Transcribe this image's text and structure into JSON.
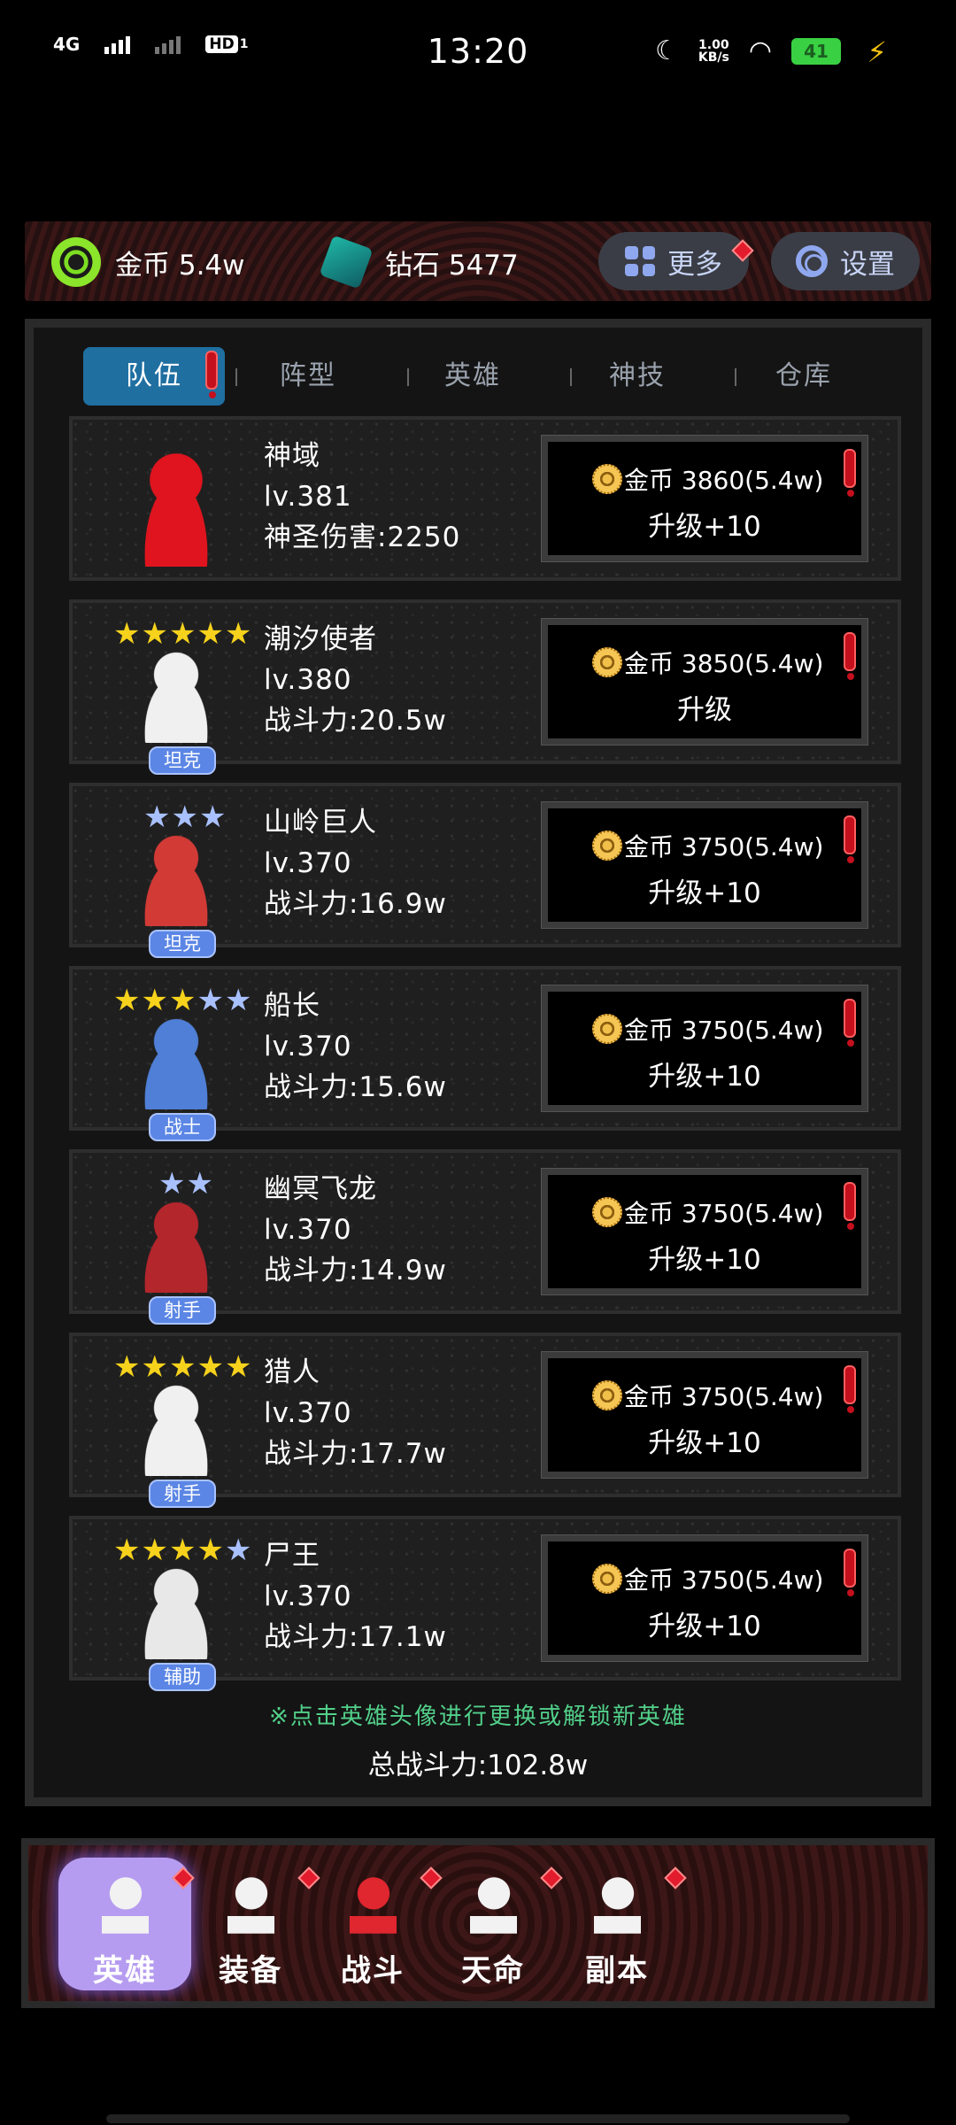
{
  "status_bar": {
    "network": "4G",
    "hd_label": "HD",
    "sim_index": "1",
    "time": "13:20",
    "speed_value": "1.00",
    "speed_unit": "KB/s",
    "battery": "41"
  },
  "resources": {
    "gold_label": "金币 5.4w",
    "diamond_label": "钻石 5477"
  },
  "top_buttons": {
    "more_label": "更多",
    "settings_label": "设置"
  },
  "tabs": [
    {
      "label": "队伍",
      "active": true,
      "alert": true
    },
    {
      "label": "阵型"
    },
    {
      "label": "英雄"
    },
    {
      "label": "神技"
    },
    {
      "label": "仓库"
    }
  ],
  "heroes": [
    {
      "name": "神域",
      "level": "lv.381",
      "stat": "神圣伤害:2250",
      "stars": 0,
      "gold_stars": 0,
      "role": "",
      "cost": "金币 3860(5.4w)",
      "action": "升级+10",
      "color": "#e0141e"
    },
    {
      "name": "潮汐使者",
      "level": "lv.380",
      "stat": "战斗力:20.5w",
      "stars": 5,
      "gold_stars": 5,
      "role": "坦克",
      "cost": "金币 3850(5.4w)",
      "action": "升级",
      "color": "#f0f0f0"
    },
    {
      "name": "山岭巨人",
      "level": "lv.370",
      "stat": "战斗力:16.9w",
      "stars": 3,
      "gold_stars": 0,
      "role": "坦克",
      "cost": "金币 3750(5.4w)",
      "action": "升级+10",
      "color": "#d23a36"
    },
    {
      "name": "船长",
      "level": "lv.370",
      "stat": "战斗力:15.6w",
      "stars": 5,
      "gold_stars": 3,
      "role": "战士",
      "cost": "金币 3750(5.4w)",
      "action": "升级+10",
      "color": "#4f7fd6"
    },
    {
      "name": "幽冥飞龙",
      "level": "lv.370",
      "stat": "战斗力:14.9w",
      "stars": 2,
      "gold_stars": 0,
      "role": "射手",
      "cost": "金币 3750(5.4w)",
      "action": "升级+10",
      "color": "#b3262c"
    },
    {
      "name": "猎人",
      "level": "lv.370",
      "stat": "战斗力:17.7w",
      "stars": 5,
      "gold_stars": 5,
      "role": "射手",
      "cost": "金币 3750(5.4w)",
      "action": "升级+10",
      "color": "#f0f0f0"
    },
    {
      "name": "尸王",
      "level": "lv.370",
      "stat": "战斗力:17.1w",
      "stars": 5,
      "gold_stars": 4,
      "role": "辅助",
      "cost": "金币 3750(5.4w)",
      "action": "升级+10",
      "color": "#e8e8e8"
    }
  ],
  "hint": "※点击英雄头像进行更换或解锁新英雄",
  "total_power": "总战斗力:102.8w",
  "bottom_nav": [
    {
      "label": "英雄",
      "icon": "skull-totem-icon",
      "active": true
    },
    {
      "label": "装备",
      "icon": "armor-icon"
    },
    {
      "label": "战斗",
      "icon": "crossed-swords-icon"
    },
    {
      "label": "天命",
      "icon": "destiny-medallion-icon"
    },
    {
      "label": "副本",
      "icon": "dungeon-gate-icon"
    }
  ],
  "colors": {
    "gold_star": "#f6d21c",
    "blue_star": "#a9c0ff",
    "alert_red": "#c40f1c",
    "hint_green": "#52d08a",
    "tab_active": "#1f6fa1"
  }
}
